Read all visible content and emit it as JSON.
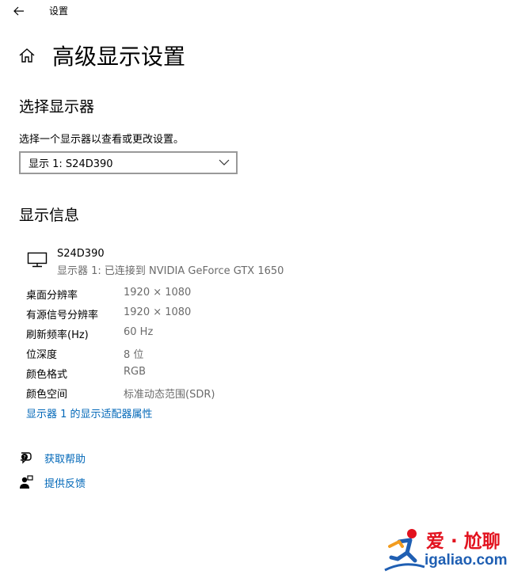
{
  "titlebar": {
    "title": "设置"
  },
  "header": {
    "page_title": "高级显示设置"
  },
  "select_display": {
    "heading": "选择显示器",
    "description": "选择一个显示器以查看或更改设置。",
    "selected_value": "显示 1: S24D390"
  },
  "display_info": {
    "heading": "显示信息",
    "monitor_name": "S24D390",
    "monitor_connection": "显示器 1: 已连接到 NVIDIA GeForce GTX 1650",
    "rows": [
      {
        "label": "桌面分辨率",
        "value": "1920 × 1080"
      },
      {
        "label": "有源信号分辨率",
        "value": "1920 × 1080"
      },
      {
        "label": "刷新频率(Hz)",
        "value": "60 Hz"
      },
      {
        "label": "位深度",
        "value": "8 位"
      },
      {
        "label": "颜色格式",
        "value": "RGB"
      },
      {
        "label": "颜色空间",
        "value": "标准动态范围(SDR)"
      }
    ],
    "adapter_link": "显示器 1 的显示适配器属性"
  },
  "help": {
    "get_help": "获取帮助",
    "feedback": "提供反馈"
  },
  "watermark": {
    "cn": "爱 · 尬聊",
    "en": "igaliao.com"
  },
  "colors": {
    "link": "#0067b8",
    "secondary_text": "#6b6b6b",
    "dropdown_border": "#999999",
    "watermark_red": "#e2121e",
    "watermark_blue": "#1f5fb3"
  }
}
